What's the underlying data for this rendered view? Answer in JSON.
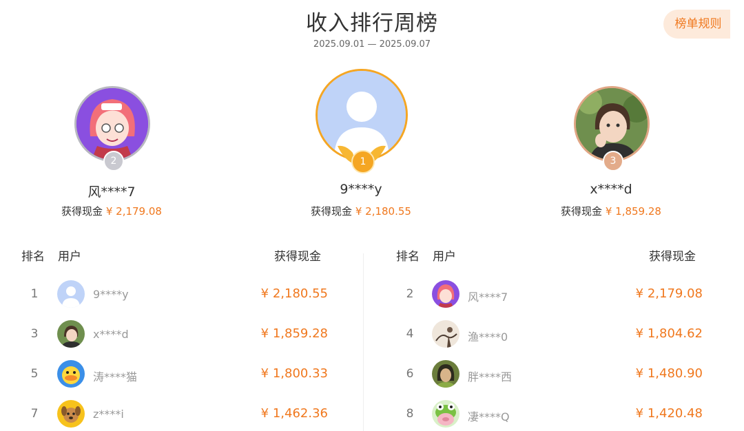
{
  "header": {
    "title": "收入排行周榜",
    "date_range": "2025.09.01 — 2025.09.07",
    "rules_label": "榜单规则"
  },
  "podium": {
    "first": {
      "rank": "1",
      "name": "9****y",
      "cash_label": "获得现金",
      "amount": "¥ 2,180.55"
    },
    "second": {
      "rank": "2",
      "name": "风****7",
      "cash_label": "获得现金",
      "amount": "¥ 2,179.08"
    },
    "third": {
      "rank": "3",
      "name": "x****d",
      "cash_label": "获得现金",
      "amount": "¥ 1,859.28"
    }
  },
  "table": {
    "headers": {
      "rank": "排名",
      "user": "用户",
      "cash": "获得现金"
    },
    "left": [
      {
        "rank": "1",
        "name": "9****y",
        "amount": "¥ 2,180.55",
        "avatar": "default-avatar-icon"
      },
      {
        "rank": "3",
        "name": "x****d",
        "amount": "¥ 1,859.28",
        "avatar": "girl-photo-avatar"
      },
      {
        "rank": "5",
        "name": "涛****猫",
        "amount": "¥ 1,800.33",
        "avatar": "duck-avatar"
      },
      {
        "rank": "7",
        "name": "z****i",
        "amount": "¥ 1,462.36",
        "avatar": "dog-avatar"
      }
    ],
    "right": [
      {
        "rank": "2",
        "name": "风****7",
        "amount": "¥ 2,179.08",
        "avatar": "anime-girl-avatar"
      },
      {
        "rank": "4",
        "name": "渔****0",
        "amount": "¥ 1,804.62",
        "avatar": "ink-painting-avatar"
      },
      {
        "rank": "6",
        "name": "胖****西",
        "amount": "¥ 1,480.90",
        "avatar": "character-avatar"
      },
      {
        "rank": "8",
        "name": "凄****Q",
        "amount": "¥ 1,420.48",
        "avatar": "frog-pig-avatar"
      }
    ]
  },
  "colors": {
    "accent_orange": "#f0781e",
    "gold": "#f5a623",
    "silver": "#b8b8c0",
    "bronze": "#e0a685",
    "rules_bg": "#fdeadb"
  }
}
